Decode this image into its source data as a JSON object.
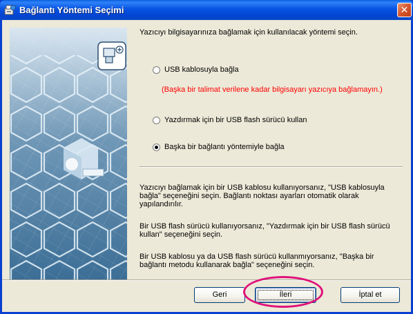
{
  "window": {
    "title": "Bağlantı Yöntemi Seçimi",
    "close_glyph": "✕",
    "title_icon": "setup-wizard-icon"
  },
  "side_panel": {
    "icon": "printer-connection-icon"
  },
  "main": {
    "intro": "Yazıcıyı bilgisayarınıza bağlamak için kullanılacak yöntemi seçin.",
    "options": [
      {
        "label": "USB kablosuyla bağla",
        "checked": false
      },
      {
        "label": "Yazdırmak için bir USB flash sürücü kullan",
        "checked": false
      },
      {
        "label": "Başka bir bağlantı yöntemiyle bağla",
        "checked": true
      }
    ],
    "warning": "(Başka bir talimat verilene kadar bilgisayarı yazıcıya bağlamayın.)",
    "descriptions": [
      "Yazıcıyı bağlamak için bir USB kablosu kullanıyorsanız, \"USB kablosuyla bağla\" seçeneğini seçin. Bağlantı noktası ayarları otomatik olarak yapılandırılır.",
      "Bir USB flash sürücü kullanıyorsanız, \"Yazdırmak için bir USB flash sürücü kullan\" seçeneğini seçin.",
      "Bir USB kablosu ya da USB flash sürücü kullanmıyorsanız, \"Başka bir bağlantı metodu kullanarak bağla\" seçeneğini seçin."
    ]
  },
  "buttons": {
    "back": "Geri",
    "next": "İleri",
    "cancel": "İptal et"
  },
  "colors": {
    "titlebar": "#0054e3",
    "dialog_bg": "#ece9d8",
    "warning_text": "#ff0000",
    "highlight": "#e0127a"
  }
}
